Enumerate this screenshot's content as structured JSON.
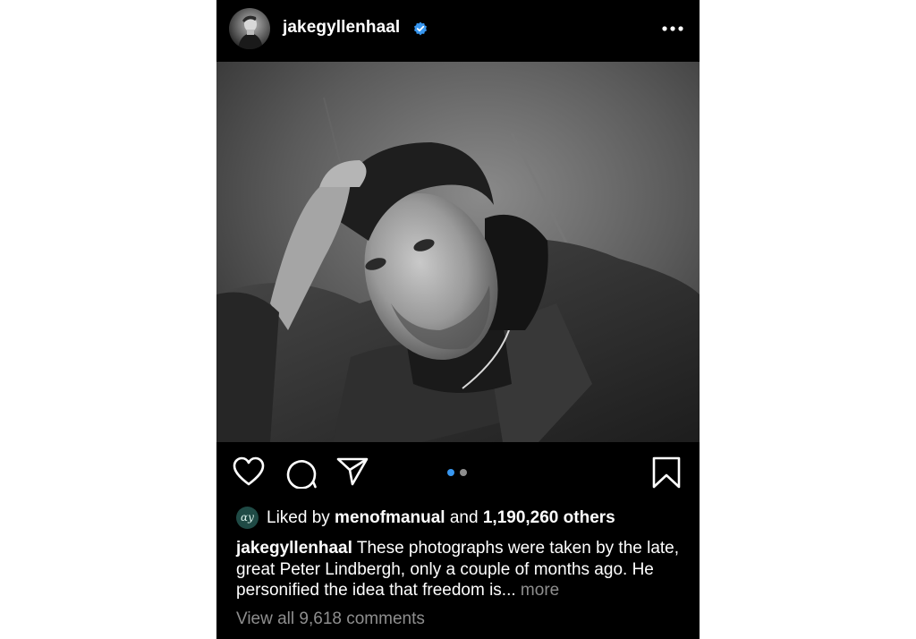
{
  "post": {
    "username": "jakegyllenhaal",
    "verified_icon": "verified-badge-icon",
    "more_icon": "more-options-icon",
    "photo_icon": "portrait-photo",
    "carousel": {
      "total": 2,
      "active": 1,
      "active_color": "#3897f0",
      "inactive_color": "#8e8e8e"
    },
    "actions": {
      "like_icon": "heart-icon",
      "comment_icon": "comment-icon",
      "share_icon": "share-icon",
      "save_icon": "bookmark-icon"
    },
    "likes": {
      "prefix": "Liked by ",
      "liker": "menofmanual",
      "middle": " and ",
      "others": "1,190,260 others",
      "liker_avatar_initials": "ɑy"
    },
    "caption": {
      "author": "jakegyllenhaal",
      "text": " These photographs were taken by the late, great Peter Lindbergh, only a couple of months ago. He personified the idea that freedom is...",
      "more_label": " more"
    },
    "view_comments": "View all 9,618 comments"
  }
}
